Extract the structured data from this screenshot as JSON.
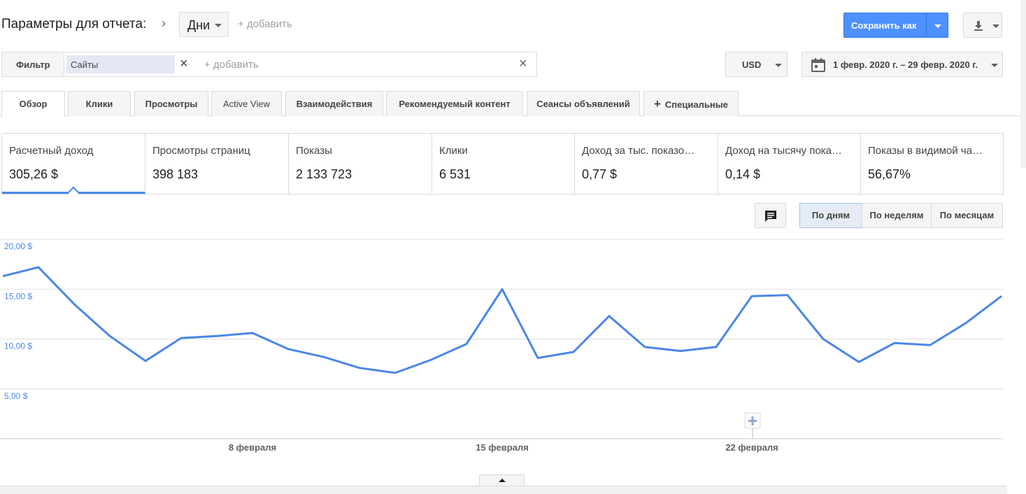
{
  "header": {
    "title": "Параметры для отчета:",
    "separator": "›",
    "dimension_value": "Дни",
    "add_dimension": "+ добавить",
    "save_button": "Сохранить как"
  },
  "filter": {
    "button_label": "Фильтр",
    "chip_label": "Сайты",
    "chip_close": "×",
    "add_placeholder": "+ добавить",
    "clear": "×"
  },
  "currency": "USD",
  "date_range": "1 февр. 2020 г. – 29 февр. 2020 г.",
  "tabs": [
    {
      "label": "Обзор",
      "active": true
    },
    {
      "label": "Клики"
    },
    {
      "label": "Просмотры"
    },
    {
      "label": "Active View"
    },
    {
      "label": "Взаимодействия"
    },
    {
      "label": "Рекомендуемый контент"
    },
    {
      "label": "Сеансы объявлений"
    },
    {
      "label": "Специальные",
      "icon": "plus-icon"
    }
  ],
  "metrics": [
    {
      "name": "Расчетный доход",
      "value": "305,26 $"
    },
    {
      "name": "Просмотры страниц",
      "value": "398 183"
    },
    {
      "name": "Показы",
      "value": "2 133 723"
    },
    {
      "name": "Клики",
      "value": "6 531"
    },
    {
      "name": "Доход за тыс. показо…",
      "value": "0,77 $"
    },
    {
      "name": "Доход на тысячу пока…",
      "value": "0,14 $"
    },
    {
      "name": "Показы в видимой ча…",
      "value": "56,67%"
    }
  ],
  "period_buttons": {
    "day": "По дням",
    "week": "По неделям",
    "month": "По месяцам"
  },
  "colors": {
    "accent": "#4d90fe",
    "line": "#4a86e8",
    "axis_label": "#4a86e8"
  },
  "chart_data": {
    "type": "line",
    "x": [
      "2020-02-01",
      "2020-02-02",
      "2020-02-03",
      "2020-02-04",
      "2020-02-05",
      "2020-02-06",
      "2020-02-07",
      "2020-02-08",
      "2020-02-09",
      "2020-02-10",
      "2020-02-11",
      "2020-02-12",
      "2020-02-13",
      "2020-02-14",
      "2020-02-15",
      "2020-02-16",
      "2020-02-17",
      "2020-02-18",
      "2020-02-19",
      "2020-02-20",
      "2020-02-21",
      "2020-02-22",
      "2020-02-23",
      "2020-02-24",
      "2020-02-25",
      "2020-02-26",
      "2020-02-27",
      "2020-02-28",
      "2020-02-29"
    ],
    "series": [
      {
        "values": [
          16.3,
          17.2,
          13.5,
          10.3,
          7.8,
          10.1,
          10.3,
          10.6,
          9.0,
          8.2,
          7.1,
          6.6,
          7.9,
          9.5,
          15.0,
          8.1,
          8.7,
          12.3,
          9.2,
          8.8,
          9.2,
          14.3,
          14.4,
          10.0,
          7.7,
          9.6,
          9.4,
          11.6,
          14.3
        ]
      }
    ],
    "y_ticks": [
      "20,00 $",
      "15,00 $",
      "10,00 $",
      "5,00 $"
    ],
    "y_tick_values": [
      20,
      15,
      10,
      5
    ],
    "ylim": [
      0,
      20
    ],
    "x_tick_labels": [
      "8 февраля",
      "15 февраля",
      "22 февраля"
    ],
    "x_tick_dates": [
      "2020-02-08",
      "2020-02-15",
      "2020-02-22"
    ],
    "grid": true
  }
}
